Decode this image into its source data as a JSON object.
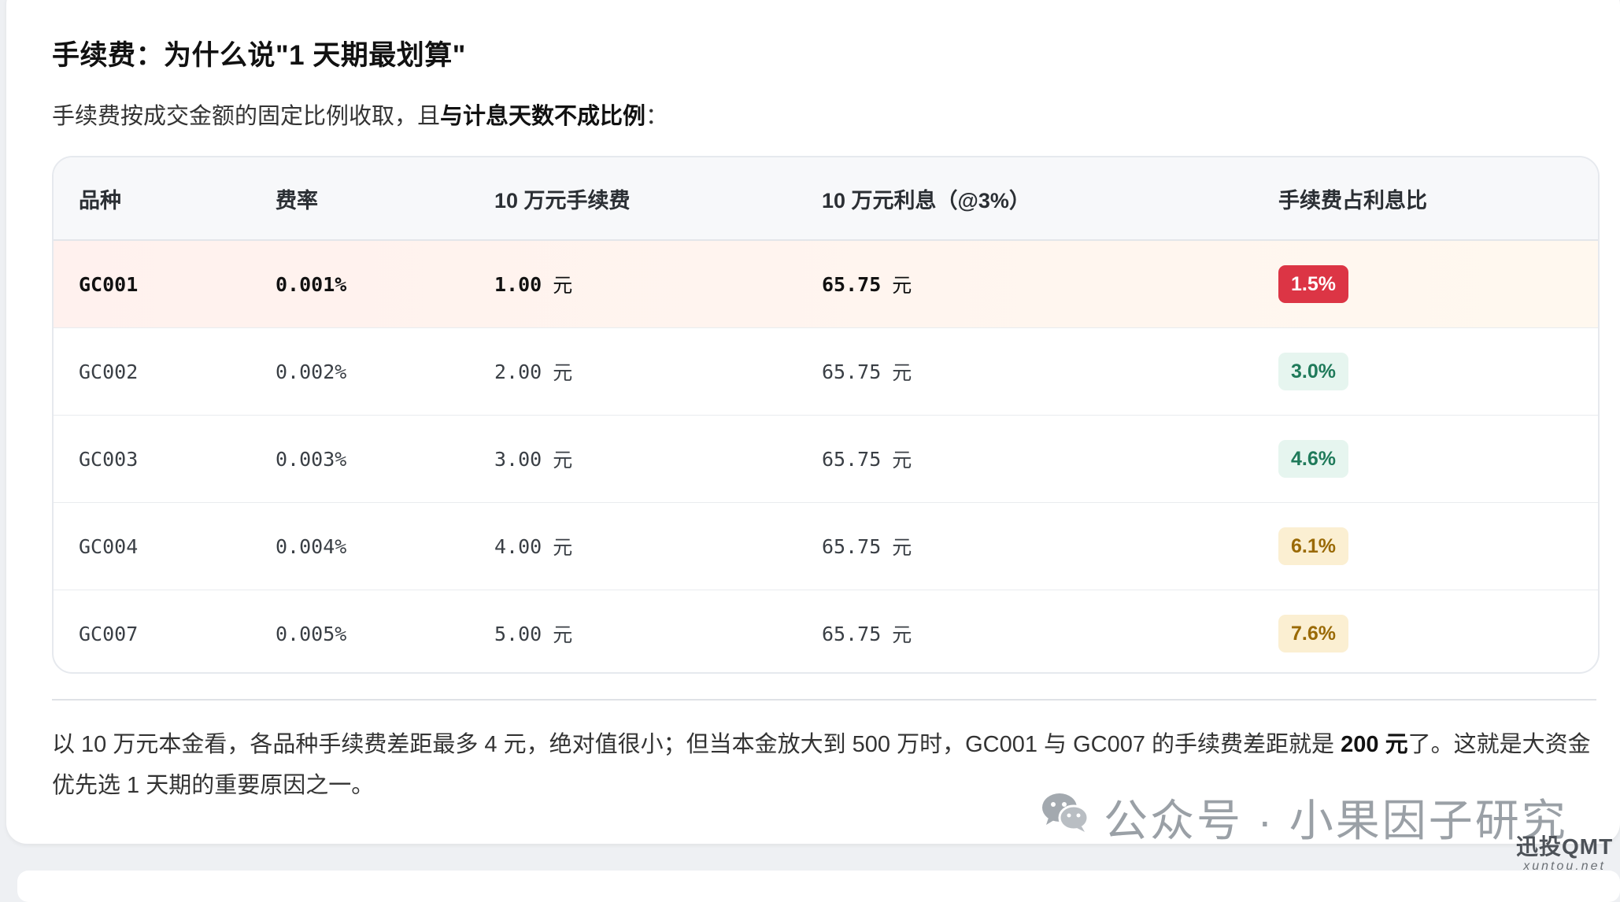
{
  "section": {
    "title": "手续费：为什么说\"1 天期最划算\"",
    "intro_prefix": "手续费按成交金额的固定比例收取，且",
    "intro_bold": "与计息天数不成比例",
    "intro_suffix": "："
  },
  "table": {
    "headers": [
      "品种",
      "费率",
      "10 万元手续费",
      "10 万元利息（@3%）",
      "手续费占利息比"
    ],
    "unit": "元",
    "rows": [
      {
        "name": "GC001",
        "rate": "0.001%",
        "fee": "1.00",
        "interest": "65.75",
        "ratio": "1.5%",
        "highlight": true,
        "badge_bg": "#dc3545",
        "badge_fg": "#ffffff"
      },
      {
        "name": "GC002",
        "rate": "0.002%",
        "fee": "2.00",
        "interest": "65.75",
        "ratio": "3.0%",
        "highlight": false,
        "badge_bg": "#e6f5ef",
        "badge_fg": "#1f7a5a"
      },
      {
        "name": "GC003",
        "rate": "0.003%",
        "fee": "3.00",
        "interest": "65.75",
        "ratio": "4.6%",
        "highlight": false,
        "badge_bg": "#e6f5ef",
        "badge_fg": "#1f7a5a"
      },
      {
        "name": "GC004",
        "rate": "0.004%",
        "fee": "4.00",
        "interest": "65.75",
        "ratio": "6.1%",
        "highlight": false,
        "badge_bg": "#fbefd2",
        "badge_fg": "#9a6a06"
      },
      {
        "name": "GC007",
        "rate": "0.005%",
        "fee": "5.00",
        "interest": "65.75",
        "ratio": "7.6%",
        "highlight": false,
        "badge_bg": "#fbefd2",
        "badge_fg": "#9a6a06"
      }
    ]
  },
  "conclusion": {
    "prefix": "以 10 万元本金看，各品种手续费差距最多 4 元，绝对值很小；但当本金放大到 500 万时，GC001 与 GC007 的手续费差距就是 ",
    "bold": "200 元",
    "suffix": "了。这就是大资金优先选 1 天期的重要原因之一。"
  },
  "watermark": {
    "icon": "wechat-icon",
    "text": "公众号 · 小果因子研究"
  },
  "corner_logo": {
    "line1": "迅投QMT",
    "line2": "xuntou.net"
  }
}
